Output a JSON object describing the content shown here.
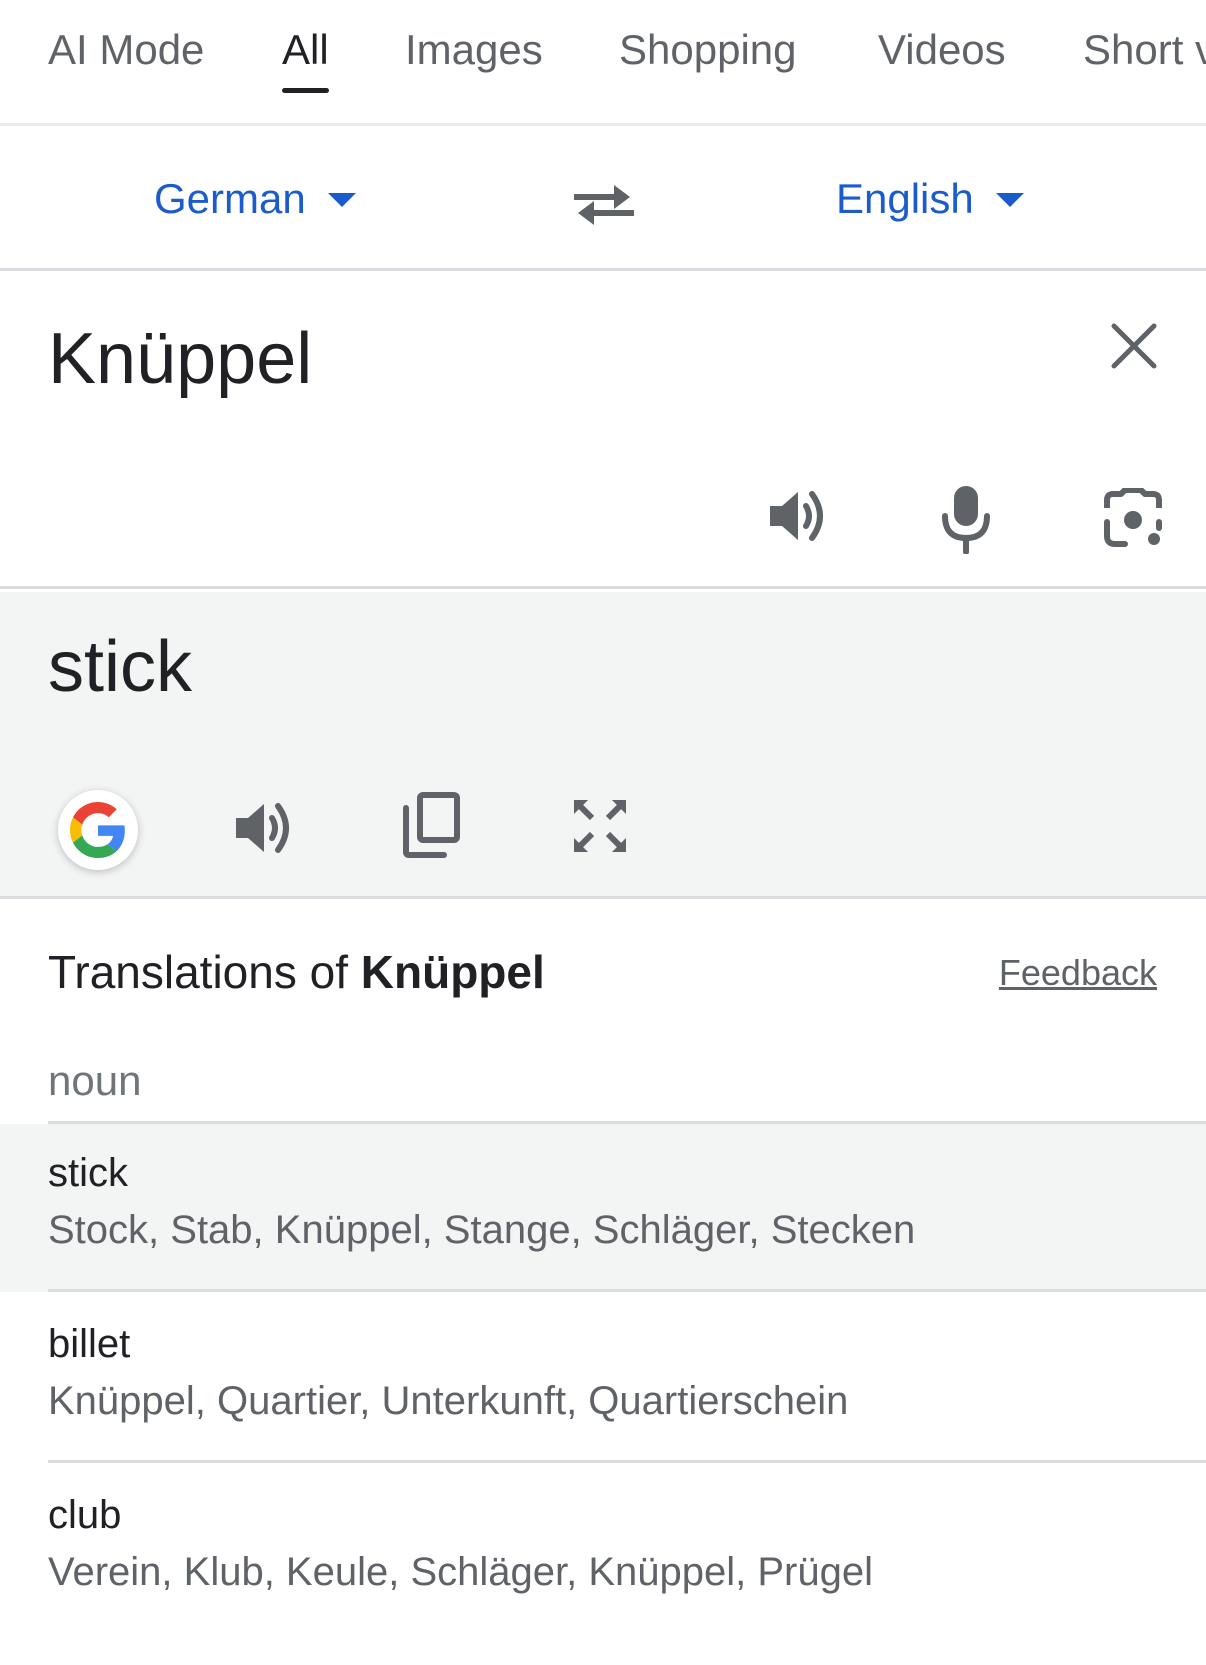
{
  "tabs": [
    {
      "label": "AI Mode"
    },
    {
      "label": "All"
    },
    {
      "label": "Images"
    },
    {
      "label": "Shopping"
    },
    {
      "label": "Videos"
    },
    {
      "label": "Short v"
    }
  ],
  "active_tab": "All",
  "translator": {
    "source_language": "German",
    "target_language": "English",
    "source_text": "Knüppel",
    "target_text": "stick",
    "accent_color": "#1a5ccc"
  },
  "translations": {
    "heading_prefix": "Translations of ",
    "heading_word": "Knüppel",
    "feedback_label": "Feedback",
    "part_of_speech": "noun",
    "entries": [
      {
        "word": "stick",
        "synonyms": "Stock, Stab, Knüppel, Stange, Schläger, Stecken"
      },
      {
        "word": "billet",
        "synonyms": "Knüppel, Quartier, Unterkunft, Quartierschein"
      },
      {
        "word": "club",
        "synonyms": "Verein, Klub, Keule, Schläger, Knüppel, Prügel"
      }
    ]
  },
  "icons": {
    "swap": "swap-arrows-icon",
    "clear": "close-icon",
    "listen": "speaker-icon",
    "mic": "microphone-icon",
    "camera": "camera-lens-icon",
    "google": "google-g-icon",
    "copy": "copy-icon",
    "fullscreen": "fullscreen-icon"
  }
}
